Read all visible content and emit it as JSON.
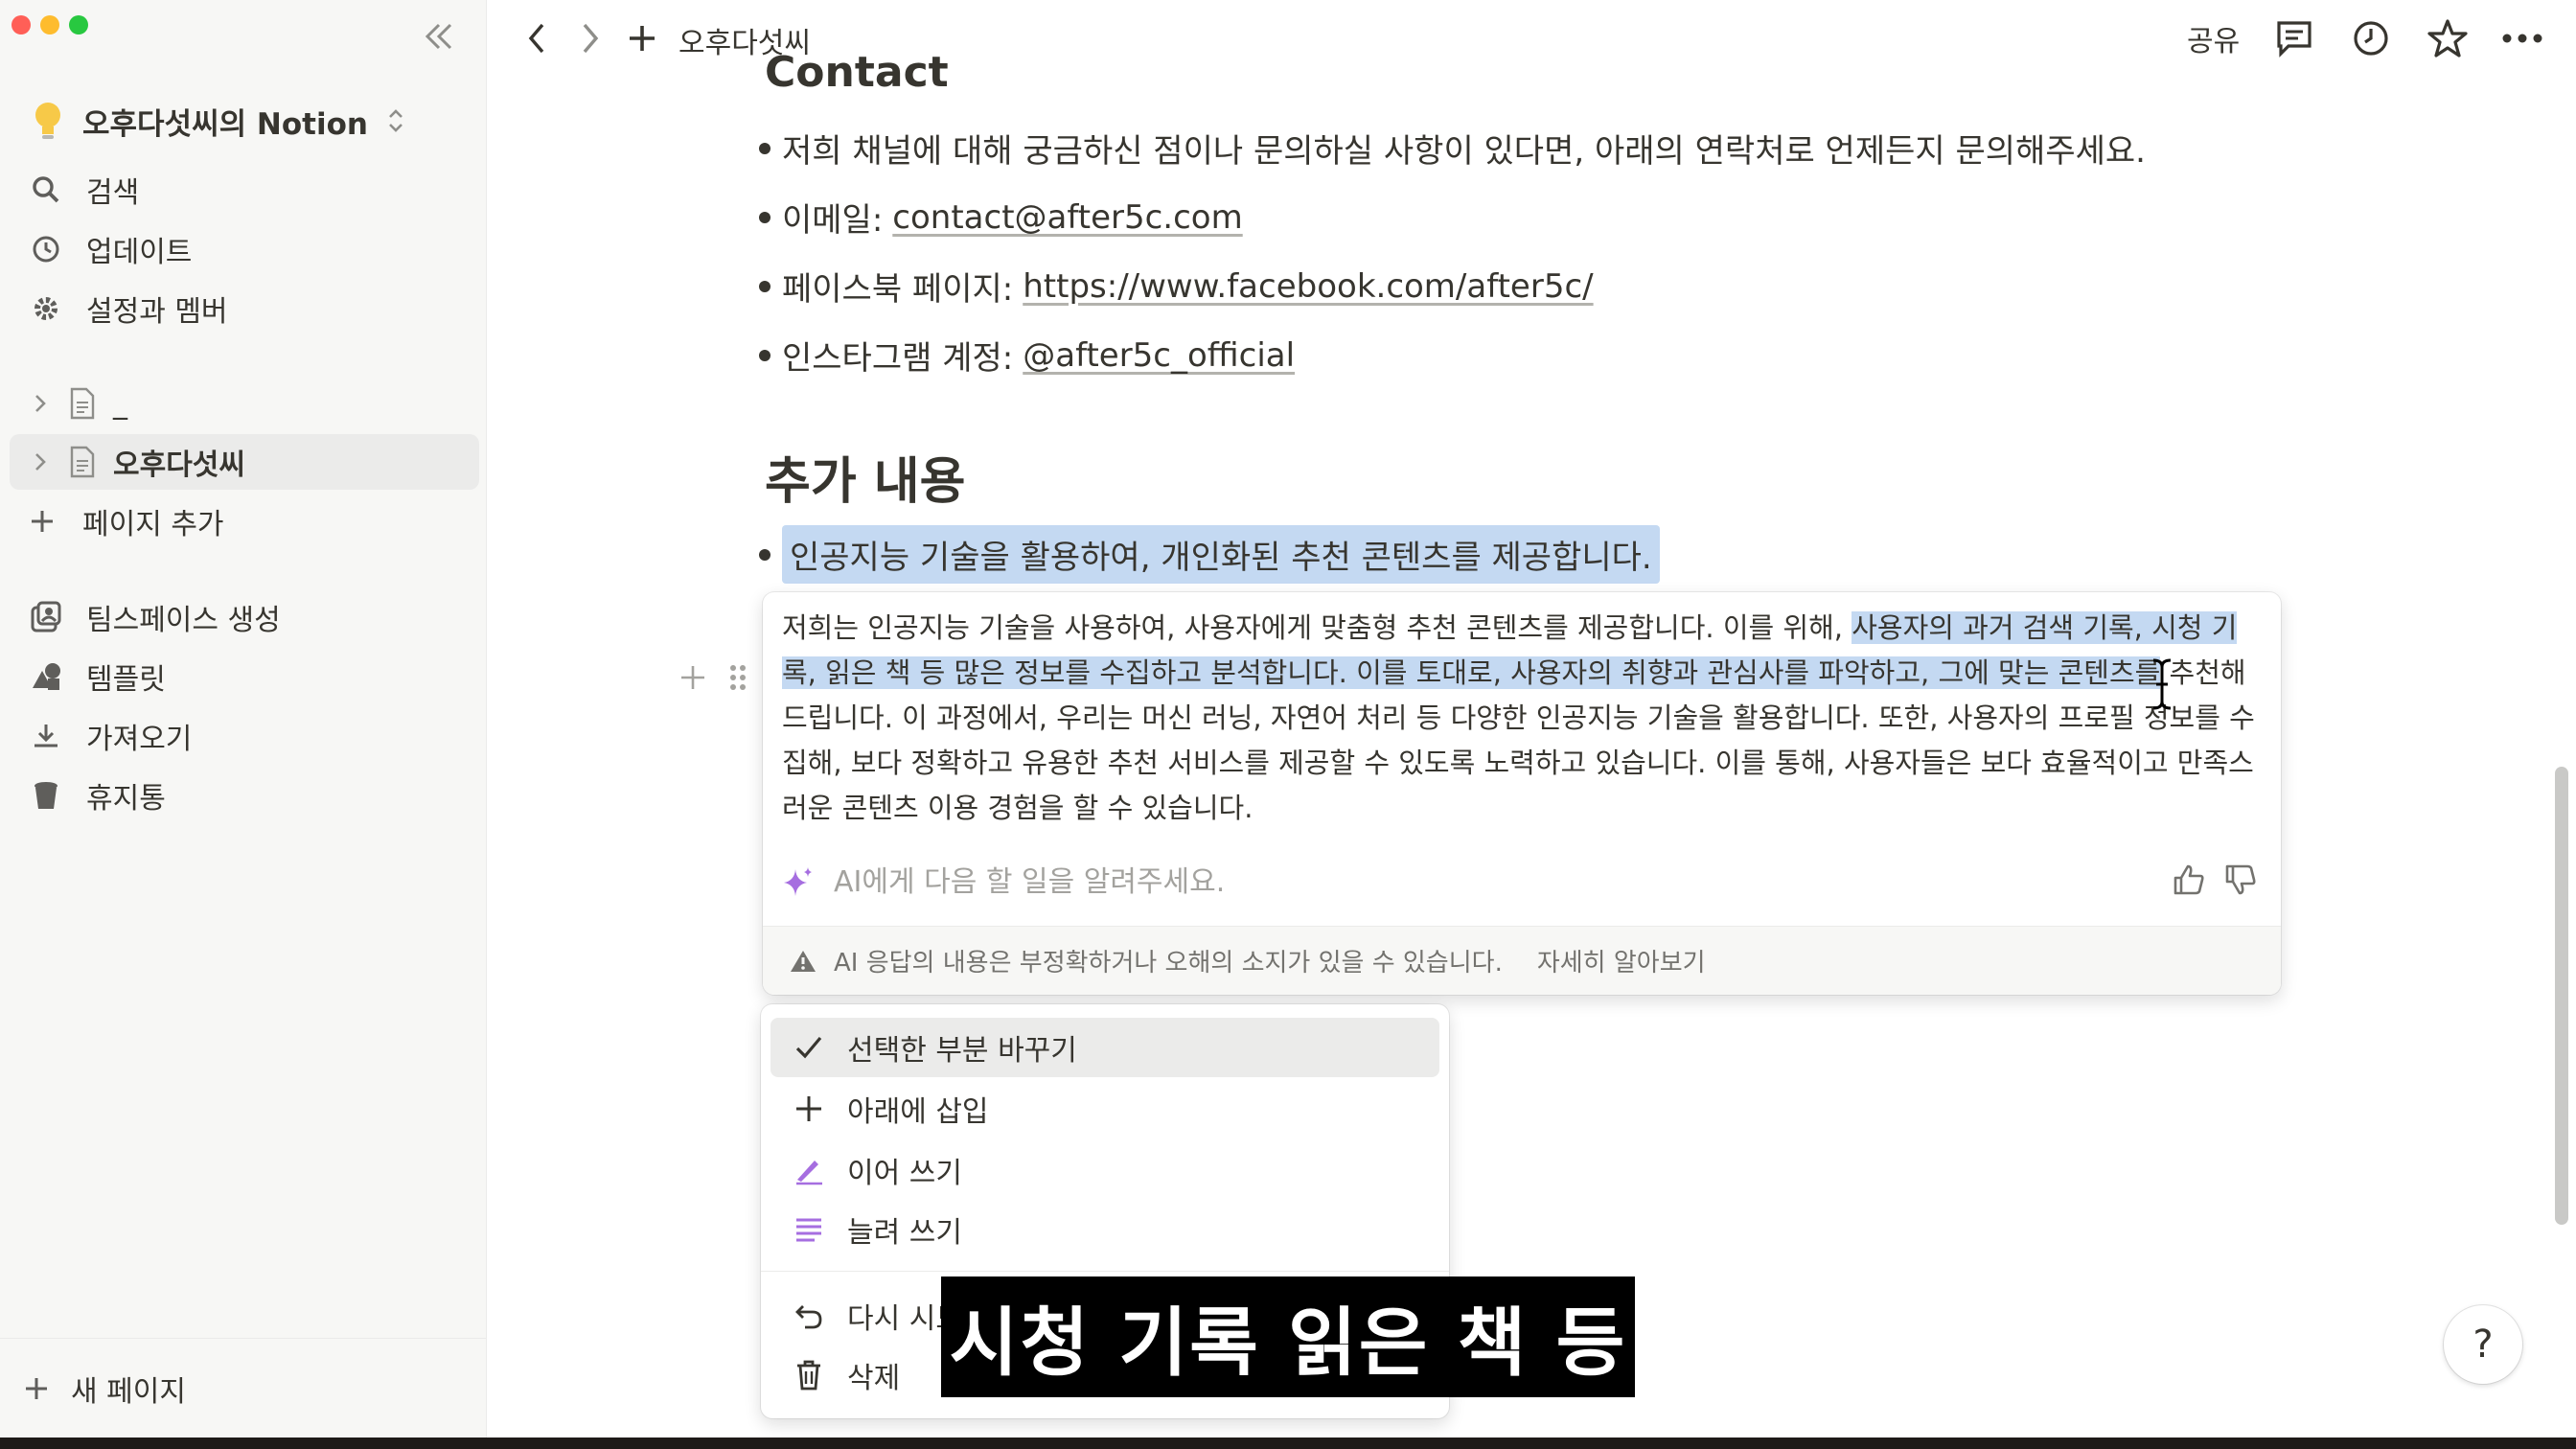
{
  "sidebar": {
    "workspace_icon": "lightbulb-icon",
    "workspace_name": "오후다섯씨의 Notion",
    "nav": [
      {
        "label": "검색",
        "icon": "search-icon"
      },
      {
        "label": "업데이트",
        "icon": "clock-icon"
      },
      {
        "label": "설정과 멤버",
        "icon": "gear-icon"
      }
    ],
    "pages": [
      {
        "label": "_",
        "active": false
      },
      {
        "label": "오후다섯씨",
        "active": true
      }
    ],
    "add_page": "페이지 추가",
    "tools": [
      {
        "label": "팀스페이스 생성",
        "icon": "teamspace-icon"
      },
      {
        "label": "템플릿",
        "icon": "shapes-icon"
      },
      {
        "label": "가져오기",
        "icon": "download-icon"
      },
      {
        "label": "휴지통",
        "icon": "trash-icon"
      }
    ],
    "new_page": "새 페이지"
  },
  "topbar": {
    "breadcrumb": "오후다섯씨",
    "share": "공유"
  },
  "content": {
    "contact_heading": "Contact",
    "contact_bullets": [
      {
        "prefix": "저희 채널에 대해 궁금하신 점이나 문의하실 사항이 있다면, 아래의 연락처로 언제든지 문의해주세요.",
        "link": ""
      },
      {
        "prefix": "이메일: ",
        "link": "contact@after5c.com"
      },
      {
        "prefix": "페이스북 페이지: ",
        "link": "https://www.facebook.com/after5c/"
      },
      {
        "prefix": "인스타그램 계정: ",
        "link": "@after5c_official"
      }
    ],
    "section_heading": "추가 내용",
    "selected_bullet": "인공지능 기술을 활용하여, 개인화된 추천 콘텐츠를 제공합니다."
  },
  "ai_panel": {
    "text_before": "저희는 인공지능 기술을 사용하여, 사용자에게 맞춤형 추천 콘텐츠를 제공합니다. 이를 위해, ",
    "text_highlight": "사용자의 과거 검색 기록, 시청 기록, 읽은 책 등 많은 정보를 수집하고 분석합니다. 이를 토대로, 사용자의 취향과 관심사를 파악하고, 그에 맞는 콘텐츠를",
    "text_after": " 추천해드립니다. 이 과정에서, 우리는 머신 러닝, 자연어 처리 등 다양한 인공지능 기술을 활용합니다. 또한, 사용자의 프로필 정보를 수집해, 보다 정확하고 유용한 추천 서비스를 제공할 수 있도록 노력하고 있습니다. 이를 통해, 사용자들은 보다 효율적이고 만족스러운 콘텐츠 이용 경험을 할 수 있습니다.",
    "prompt_placeholder": "AI에게 다음 할 일을 알려주세요.",
    "warning": "AI 응답의 내용은 부정확하거나 오해의 소지가 있을 수 있습니다.",
    "learn_more": "자세히 알아보기"
  },
  "menu": {
    "items": [
      {
        "label": "선택한 부분 바꾸기",
        "icon": "check-icon",
        "active": true
      },
      {
        "label": "아래에 삽입",
        "icon": "plus-icon",
        "active": false
      },
      {
        "label": "이어 쓰기",
        "icon": "pen-icon",
        "active": false
      },
      {
        "label": "늘려 쓰기",
        "icon": "lines-icon",
        "active": false
      }
    ],
    "secondary": [
      {
        "label": "다시 시도",
        "icon": "retry-icon"
      },
      {
        "label": "삭제",
        "icon": "trash-icon"
      }
    ]
  },
  "caption": "시청 기록 읽은 책 등",
  "help": "?",
  "colors": {
    "highlight": "#c4d9f2",
    "sidebar_bg": "#f7f7f5",
    "ai_sparkle": "#a66ee0"
  }
}
